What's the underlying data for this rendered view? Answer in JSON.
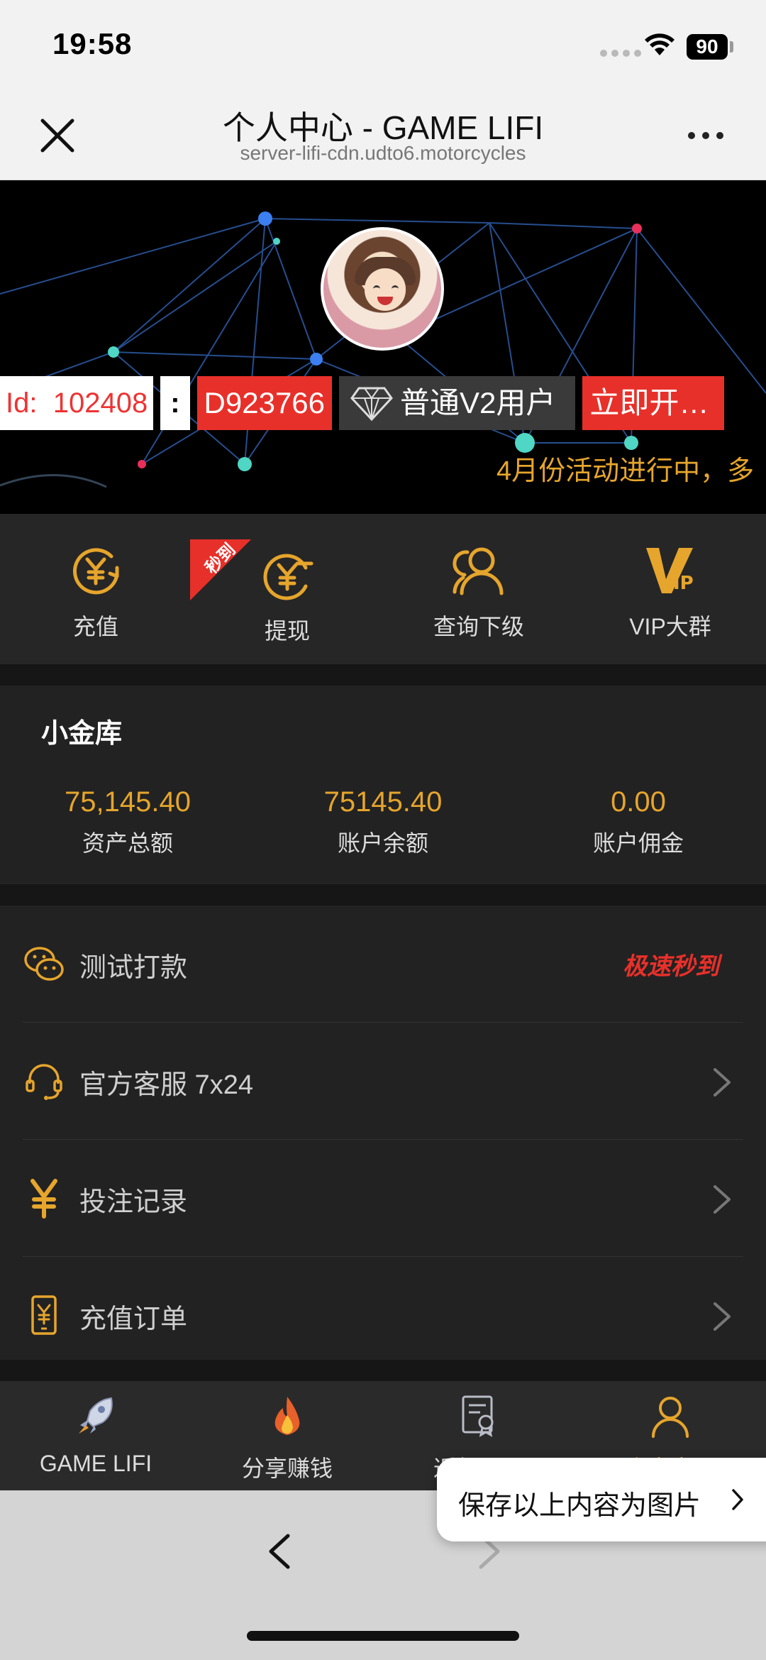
{
  "status_bar": {
    "time": "19:58",
    "battery": "90"
  },
  "header": {
    "title": "个人中心 - GAME LIFI",
    "url": "server-lifi-cdn.udto6.motorcycles"
  },
  "profile": {
    "id_label": "Id:",
    "id_value": "102408",
    "colon": ":",
    "code": "D923766",
    "level": "普通V2用户",
    "open_button": "立即开…",
    "marquee": "4月份活动进行中，多"
  },
  "quick_actions": [
    {
      "label": "充值",
      "icon": "yuan-recharge-icon"
    },
    {
      "label": "提现",
      "icon": "yuan-withdraw-icon",
      "tag": "秒到"
    },
    {
      "label": "查询下级",
      "icon": "users-icon"
    },
    {
      "label": "VIP大群",
      "icon": "vip-icon"
    }
  ],
  "vault": {
    "title": "小金库",
    "stats": [
      {
        "value": "75,145.40",
        "label": "资产总额"
      },
      {
        "value": "75145.40",
        "label": "账户余额"
      },
      {
        "value": "0.00",
        "label": "账户佣金"
      }
    ]
  },
  "menu": [
    {
      "label": "测试打款",
      "icon": "wechat-icon",
      "badge": "极速秒到"
    },
    {
      "label": "官方客服 7x24",
      "icon": "headset-icon"
    },
    {
      "label": "投注记录",
      "icon": "yuan-icon"
    },
    {
      "label": "充值订单",
      "icon": "phone-yuan-icon"
    }
  ],
  "tabs": [
    {
      "label": "GAME LIFI",
      "icon": "rocket-icon"
    },
    {
      "label": "分享赚钱",
      "icon": "fire-icon"
    },
    {
      "label": "返佣记录",
      "icon": "certificate-icon"
    },
    {
      "label": "个人中心",
      "icon": "person-icon",
      "active": true
    }
  ],
  "save_prompt": "保存以上内容为图片",
  "colors": {
    "accent": "#e6a52c",
    "red": "#e8302a",
    "panel": "#222222"
  }
}
